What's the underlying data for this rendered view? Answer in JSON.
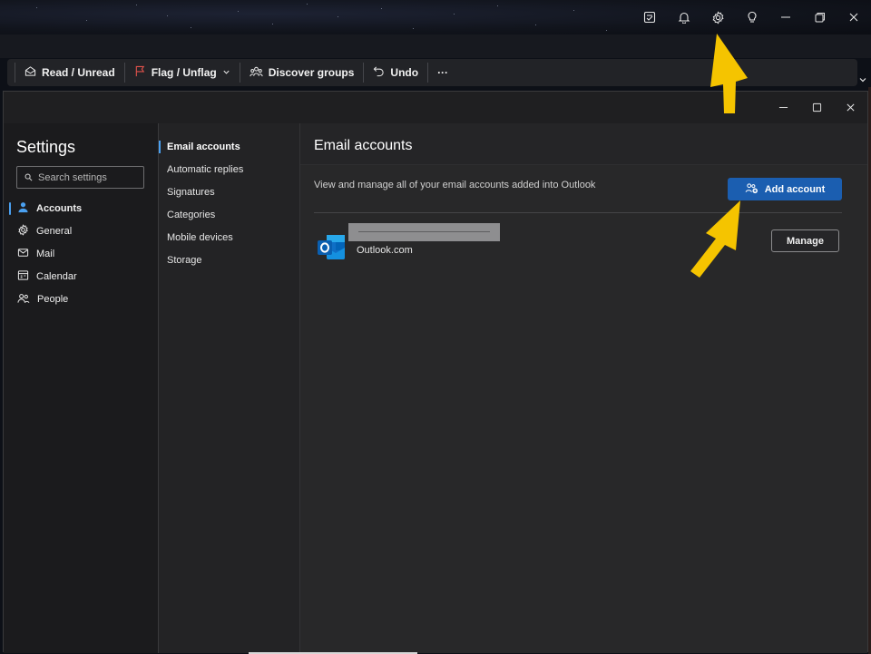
{
  "ribbon": {
    "items": [
      {
        "label": "Read / Unread",
        "icon": "envelope-open-icon"
      },
      {
        "label": "Flag / Unflag",
        "icon": "flag-icon"
      },
      {
        "label": "Discover groups",
        "icon": "people-group-icon"
      },
      {
        "label": "Undo",
        "icon": "undo-icon"
      },
      {
        "label": "···",
        "icon": "more-icon"
      }
    ]
  },
  "settings": {
    "title": "Settings",
    "search_placeholder": "Search settings",
    "nav": [
      {
        "label": "Accounts",
        "icon": "person-icon",
        "active": true
      },
      {
        "label": "General",
        "icon": "gear-icon"
      },
      {
        "label": "Mail",
        "icon": "mail-icon"
      },
      {
        "label": "Calendar",
        "icon": "calendar-icon"
      },
      {
        "label": "People",
        "icon": "people-icon"
      }
    ],
    "subnav": [
      {
        "label": "Email accounts",
        "active": true
      },
      {
        "label": "Automatic replies"
      },
      {
        "label": "Signatures"
      },
      {
        "label": "Categories"
      },
      {
        "label": "Mobile devices"
      },
      {
        "label": "Storage"
      }
    ]
  },
  "content": {
    "title": "Email accounts",
    "description": "View and manage all of your email accounts added into Outlook",
    "add_account_label": "Add account",
    "account": {
      "type": "Outlook.com",
      "manage_label": "Manage"
    }
  },
  "colors": {
    "accent": "#1b5eb0",
    "highlight_arrow": "#f5c400",
    "active_indicator": "#4aa0f0"
  }
}
